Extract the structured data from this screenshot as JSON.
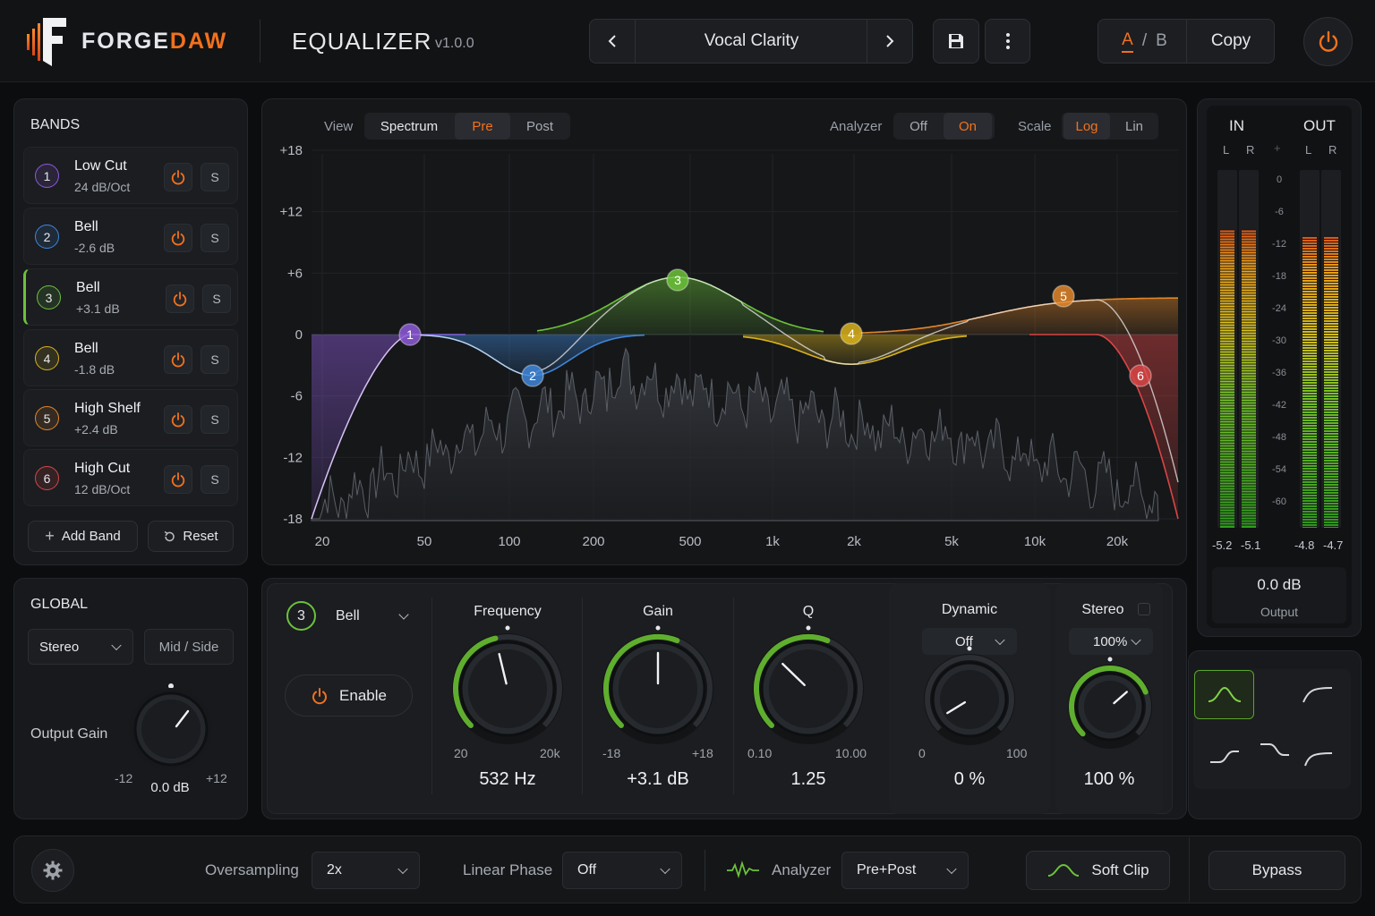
{
  "app": {
    "brand_left": "FORGE",
    "brand_right": "DAW",
    "plugin_title": "EQUALIZER",
    "version": "v1.0.0"
  },
  "preset": {
    "name": "Vocal Clarity"
  },
  "ab": {
    "a": "A",
    "sep": "/",
    "b": "B",
    "copy": "Copy"
  },
  "bands_panel": {
    "title": "BANDS",
    "bands": [
      {
        "num": "1",
        "name": "Low Cut",
        "value": "24 dB/Oct",
        "color": "#8e5bd9",
        "solo": "S"
      },
      {
        "num": "2",
        "name": "Bell",
        "value": "-2.6 dB",
        "color": "#3f86d9",
        "solo": "S"
      },
      {
        "num": "3",
        "name": "Bell",
        "value": "+3.1 dB",
        "color": "#6cc23a",
        "solo": "S"
      },
      {
        "num": "4",
        "name": "Bell",
        "value": "-1.8 dB",
        "color": "#d9b21c",
        "solo": "S"
      },
      {
        "num": "5",
        "name": "High Shelf",
        "value": "+2.4 dB",
        "color": "#e2862a",
        "solo": "S"
      },
      {
        "num": "6",
        "name": "High Cut",
        "value": "12 dB/Oct",
        "color": "#d94545",
        "solo": "S"
      }
    ],
    "add_band": "Add Band",
    "reset": "Reset"
  },
  "global": {
    "title": "GLOBAL",
    "channel_mode": "Stereo",
    "mid_side": "Mid / Side",
    "output_gain_label": "Output Gain",
    "min": "-12",
    "max": "+12",
    "value": "0.0 dB",
    "value_db": 0.0
  },
  "graph": {
    "view_label": "View",
    "view_spectrum": "Spectrum",
    "view_pre": "Pre",
    "view_post": "Post",
    "analyzer_label": "Analyzer",
    "analyzer_off": "Off",
    "analyzer_on": "On",
    "scale_label": "Scale",
    "scale_log": "Log",
    "scale_lin": "Lin",
    "y_ticks": [
      "+18",
      "+12",
      "+6",
      "0",
      "-6",
      "-12",
      "-18"
    ],
    "x_ticks": [
      "20",
      "50",
      "100",
      "200",
      "500",
      "1k",
      "2k",
      "5k",
      "10k",
      "20k"
    ],
    "nodes": [
      "1",
      "2",
      "3",
      "4",
      "5",
      "6"
    ]
  },
  "meters": {
    "in_label": "IN",
    "out_label": "OUT",
    "l": "L",
    "r": "R",
    "scale": [
      "0",
      "-6",
      "-12",
      "-18",
      "-24",
      "-30",
      "-36",
      "-42",
      "-48",
      "-54",
      "-60"
    ],
    "in_l": "-5.2",
    "in_r": "-5.1",
    "out_l": "-4.8",
    "out_r": "-4.7",
    "output_value": "0.0 dB",
    "output_label": "Output"
  },
  "editor": {
    "band_num": "3",
    "band_type": "Bell",
    "enable": "Enable",
    "frequency": {
      "title": "Frequency",
      "min": "20",
      "max": "20k",
      "value": "532 Hz"
    },
    "gain": {
      "title": "Gain",
      "min": "-18",
      "max": "+18",
      "value": "+3.1 dB"
    },
    "q": {
      "title": "Q",
      "min": "0.10",
      "max": "10.00",
      "value": "1.25"
    },
    "dynamic": {
      "title": "Dynamic",
      "mode": "Off",
      "min": "0",
      "max": "100",
      "value": "0 %"
    },
    "stereo": {
      "title": "Stereo",
      "mode": "100%",
      "value": "100 %"
    }
  },
  "footer": {
    "oversampling_label": "Oversampling",
    "oversampling_value": "2x",
    "linear_phase_label": "Linear Phase",
    "linear_phase_value": "Off",
    "analyzer_label": "Analyzer",
    "analyzer_value": "Pre+Post",
    "soft_clip": "Soft Clip",
    "bypass": "Bypass"
  },
  "colors": {
    "accent": "#f2711c",
    "green": "#6cc23a",
    "bg": "#0c0d0f",
    "panel": "#17191c"
  }
}
